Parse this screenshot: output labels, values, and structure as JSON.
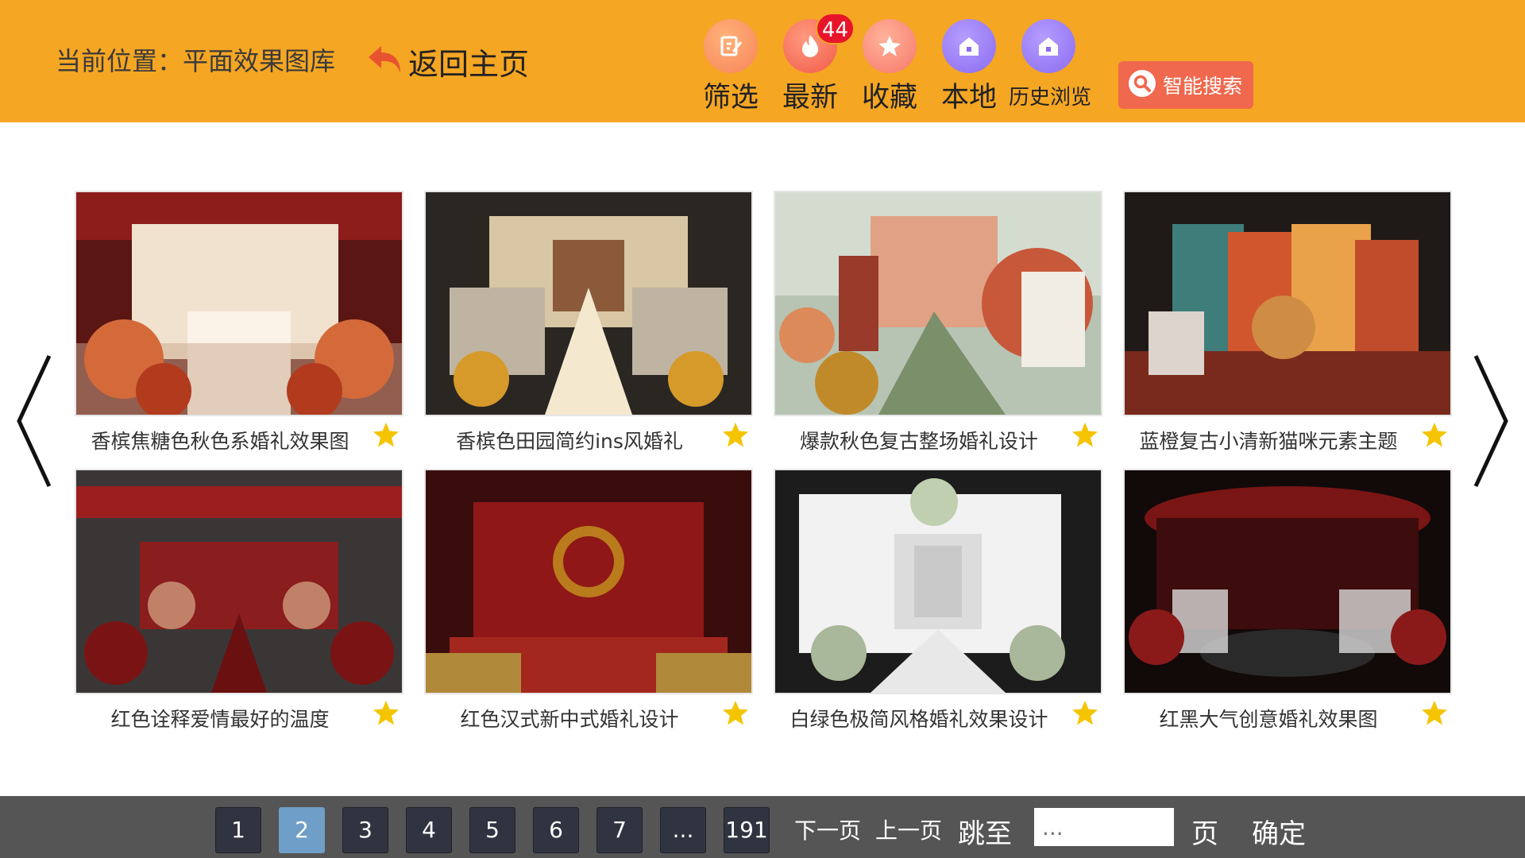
{
  "header": {
    "location_label": "当前位置：平面效果图库",
    "back_label": "返回主页",
    "nav": [
      {
        "label": "筛选",
        "icon": "filter-edit-icon",
        "color": "#f7845a"
      },
      {
        "label": "最新",
        "icon": "flame-icon",
        "color": "#f25a4a",
        "badge": "44"
      },
      {
        "label": "收藏",
        "icon": "star-icon",
        "color": "#f7786a"
      },
      {
        "label": "本地",
        "icon": "home-icon",
        "color": "#8b6cf0"
      },
      {
        "label": "历史浏览",
        "icon": "history-home-icon",
        "color": "#8b6cf0"
      }
    ],
    "search_label": "智能搜索"
  },
  "gallery": {
    "items": [
      {
        "title": "香槟焦糖色秋色系婚礼效果图"
      },
      {
        "title": "香槟色田园简约ins风婚礼"
      },
      {
        "title": "爆款秋色复古整场婚礼设计"
      },
      {
        "title": "蓝橙复古小清新猫咪元素主题"
      },
      {
        "title": "红色诠释爱情最好的温度"
      },
      {
        "title": "红色汉式新中式婚礼设计"
      },
      {
        "title": "白绿色极简风格婚礼效果设计"
      },
      {
        "title": "红黑大气创意婚礼效果图"
      }
    ]
  },
  "pagination": {
    "pages": [
      "1",
      "2",
      "3",
      "4",
      "5",
      "6",
      "7",
      "...",
      "191"
    ],
    "current": "2",
    "next_label": "下一页",
    "prev_label": "上一页",
    "jump_label": "跳至",
    "jump_placeholder": "...",
    "page_unit": "页",
    "confirm_label": "确定"
  },
  "colors": {
    "header_bg": "#f5a623",
    "footer_bg": "#555555",
    "active_page": "#6f9fc8",
    "search_btn": "#f0684d",
    "star": "#f5c400"
  }
}
